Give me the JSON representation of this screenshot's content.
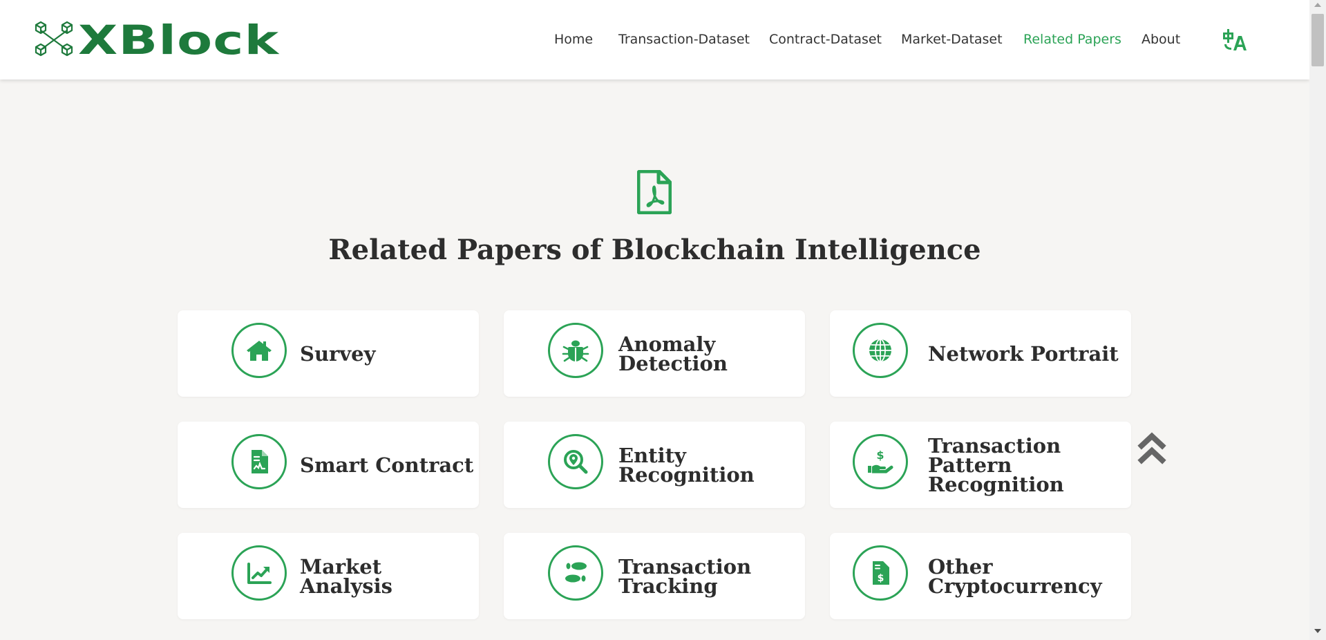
{
  "brand": {
    "name": "XBlock",
    "color": "#1e7a3c"
  },
  "nav": {
    "items": [
      {
        "label": "Home"
      },
      {
        "label": "Transaction-Dataset"
      },
      {
        "label": "Contract-Dataset"
      },
      {
        "label": "Market-Dataset"
      },
      {
        "label": "Related Papers",
        "active": true
      },
      {
        "label": "About"
      }
    ],
    "language_icon": "translate-icon"
  },
  "hero": {
    "icon": "pdf-file-icon",
    "title": "Related Papers of Blockchain Intelligence"
  },
  "categories": [
    {
      "label": "Survey",
      "icon": "home-icon"
    },
    {
      "label": "Anomaly Detection",
      "icon": "bug-icon"
    },
    {
      "label": "Network Portrait",
      "icon": "globe-icon"
    },
    {
      "label": "Smart Contract",
      "icon": "contract-document-icon"
    },
    {
      "label": "Entity Recognition",
      "icon": "search-location-icon"
    },
    {
      "label": "Transaction Pattern Recognition",
      "icon": "hand-dollar-icon"
    },
    {
      "label": "Market Analysis",
      "icon": "chart-line-icon"
    },
    {
      "label": "Transaction Tracking",
      "icon": "footprints-icon"
    },
    {
      "label": "Other Cryptocurrency",
      "icon": "invoice-dollar-icon"
    }
  ],
  "colors": {
    "accent": "#2ba356",
    "background": "#f6f5f3",
    "text": "#2d2d2d"
  },
  "back_to_top_icon": "double-chevron-up-icon"
}
